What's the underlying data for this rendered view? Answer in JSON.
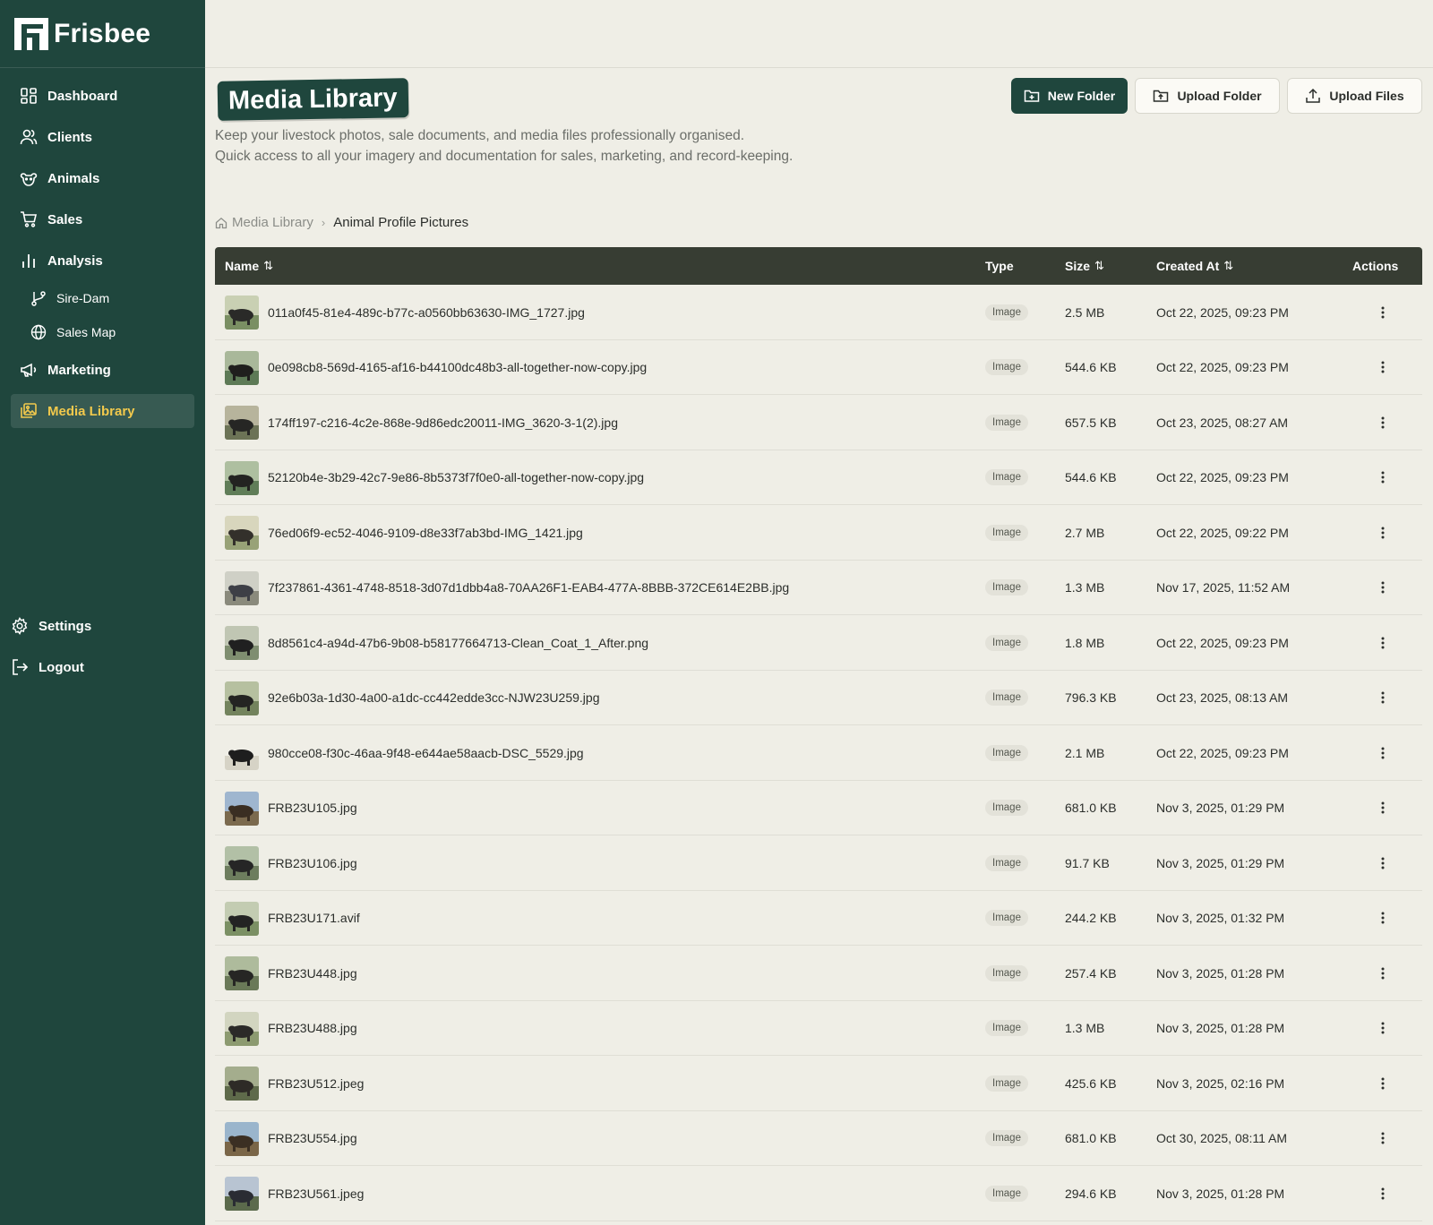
{
  "app": {
    "name": "Frisbee"
  },
  "sidebar": {
    "items": [
      {
        "label": "Dashboard",
        "icon": "dashboard-icon"
      },
      {
        "label": "Clients",
        "icon": "users-icon"
      },
      {
        "label": "Animals",
        "icon": "paw-icon"
      },
      {
        "label": "Sales",
        "icon": "cart-icon"
      },
      {
        "label": "Analysis",
        "icon": "bar-chart-icon"
      },
      {
        "label": "Sire-Dam",
        "icon": "git-branch-icon"
      },
      {
        "label": "Sales Map",
        "icon": "globe-icon"
      },
      {
        "label": "Marketing",
        "icon": "megaphone-icon"
      },
      {
        "label": "Media Library",
        "icon": "images-icon",
        "active": true
      }
    ],
    "bottom": [
      {
        "label": "Settings",
        "icon": "gear-icon"
      },
      {
        "label": "Logout",
        "icon": "logout-icon"
      }
    ]
  },
  "page": {
    "title": "Media Library",
    "subtitle_line1": "Keep your livestock photos, sale documents, and media files professionally organised.",
    "subtitle_line2": "Quick access to all your imagery and documentation for sales, marketing, and record-keeping."
  },
  "toolbar": {
    "new_folder": "New Folder",
    "upload_folder": "Upload Folder",
    "upload_files": "Upload Files"
  },
  "breadcrumb": {
    "root": "Media Library",
    "current": "Animal Profile Pictures"
  },
  "table": {
    "columns": {
      "name": "Name",
      "type": "Type",
      "size": "Size",
      "created": "Created At",
      "actions": "Actions"
    },
    "rows": [
      {
        "name": "011a0f45-81e4-489c-b77c-a0560bb63630-IMG_1727.jpg",
        "type": "Image",
        "size": "2.5 MB",
        "created": "Oct 22, 2025, 09:23 PM"
      },
      {
        "name": "0e098cb8-569d-4165-af16-b44100dc48b3-all-together-now-copy.jpg",
        "type": "Image",
        "size": "544.6 KB",
        "created": "Oct 22, 2025, 09:23 PM"
      },
      {
        "name": "174ff197-c216-4c2e-868e-9d86edc20011-IMG_3620-3-1(2).jpg",
        "type": "Image",
        "size": "657.5 KB",
        "created": "Oct 23, 2025, 08:27 AM"
      },
      {
        "name": "52120b4e-3b29-42c7-9e86-8b5373f7f0e0-all-together-now-copy.jpg",
        "type": "Image",
        "size": "544.6 KB",
        "created": "Oct 22, 2025, 09:23 PM"
      },
      {
        "name": "76ed06f9-ec52-4046-9109-d8e33f7ab3bd-IMG_1421.jpg",
        "type": "Image",
        "size": "2.7 MB",
        "created": "Oct 22, 2025, 09:22 PM"
      },
      {
        "name": "7f237861-4361-4748-8518-3d07d1dbb4a8-70AA26F1-EAB4-477A-8BBB-372CE614E2BB.jpg",
        "type": "Image",
        "size": "1.3 MB",
        "created": "Nov 17, 2025, 11:52 AM"
      },
      {
        "name": "8d8561c4-a94d-47b6-9b08-b58177664713-Clean_Coat_1_After.png",
        "type": "Image",
        "size": "1.8 MB",
        "created": "Oct 22, 2025, 09:23 PM"
      },
      {
        "name": "92e6b03a-1d30-4a00-a1dc-cc442edde3cc-NJW23U259.jpg",
        "type": "Image",
        "size": "796.3 KB",
        "created": "Oct 23, 2025, 08:13 AM"
      },
      {
        "name": "980cce08-f30c-46aa-9f48-e644ae58aacb-DSC_5529.jpg",
        "type": "Image",
        "size": "2.1 MB",
        "created": "Oct 22, 2025, 09:23 PM"
      },
      {
        "name": "FRB23U105.jpg",
        "type": "Image",
        "size": "681.0 KB",
        "created": "Nov 3, 2025, 01:29 PM"
      },
      {
        "name": "FRB23U106.jpg",
        "type": "Image",
        "size": "91.7 KB",
        "created": "Nov 3, 2025, 01:29 PM"
      },
      {
        "name": "FRB23U171.avif",
        "type": "Image",
        "size": "244.2 KB",
        "created": "Nov 3, 2025, 01:32 PM"
      },
      {
        "name": "FRB23U448.jpg",
        "type": "Image",
        "size": "257.4 KB",
        "created": "Nov 3, 2025, 01:28 PM"
      },
      {
        "name": "FRB23U488.jpg",
        "type": "Image",
        "size": "1.3 MB",
        "created": "Nov 3, 2025, 01:28 PM"
      },
      {
        "name": "FRB23U512.jpeg",
        "type": "Image",
        "size": "425.6 KB",
        "created": "Nov 3, 2025, 02:16 PM"
      },
      {
        "name": "FRB23U554.jpg",
        "type": "Image",
        "size": "681.0 KB",
        "created": "Oct 30, 2025, 08:11 AM"
      },
      {
        "name": "FRB23U561.jpeg",
        "type": "Image",
        "size": "294.6 KB",
        "created": "Nov 3, 2025, 01:28 PM"
      }
    ]
  },
  "colors": {
    "sidebar": "#1f463d",
    "header_row": "#373d33",
    "background": "#efeee6",
    "active_accent": "#f2c94c"
  }
}
